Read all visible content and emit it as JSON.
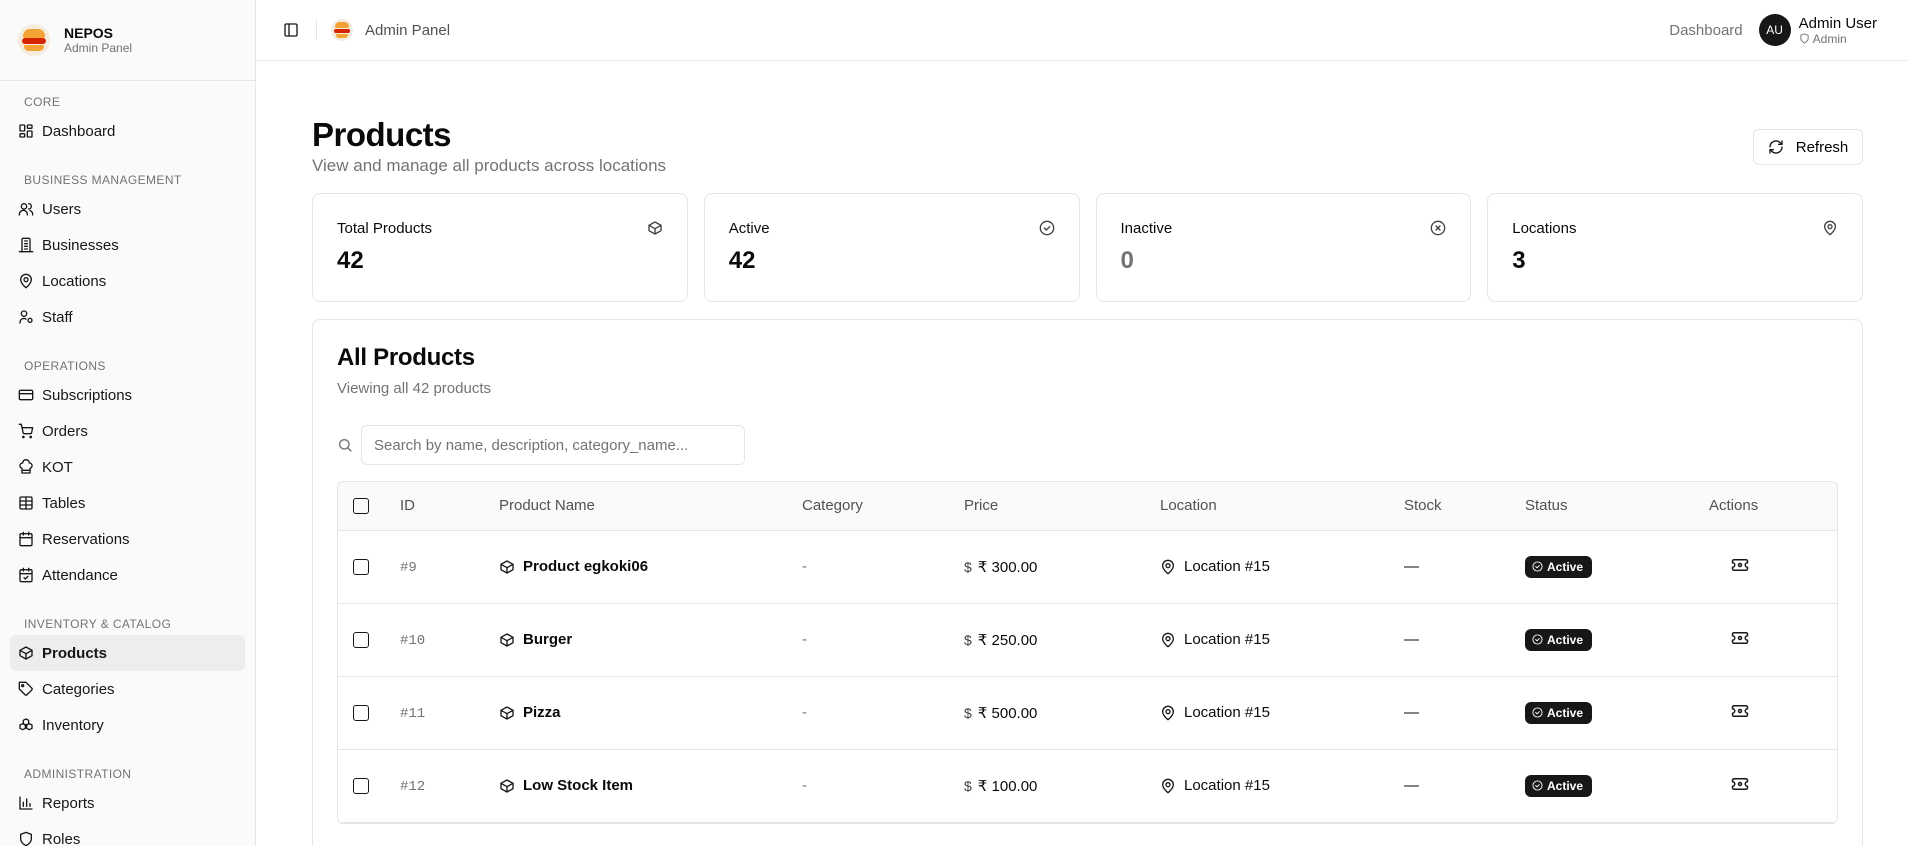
{
  "brand": {
    "name": "NEPOS",
    "subtitle": "Admin Panel"
  },
  "sidebar": {
    "sections": [
      {
        "label": "CORE",
        "items": [
          {
            "label": "Dashboard",
            "icon": "dashboard-icon"
          }
        ]
      },
      {
        "label": "BUSINESS MANAGEMENT",
        "items": [
          {
            "label": "Users",
            "icon": "users-icon"
          },
          {
            "label": "Businesses",
            "icon": "building-icon"
          },
          {
            "label": "Locations",
            "icon": "map-pin-icon"
          },
          {
            "label": "Staff",
            "icon": "staff-icon"
          }
        ]
      },
      {
        "label": "OPERATIONS",
        "items": [
          {
            "label": "Subscriptions",
            "icon": "credit-card-icon"
          },
          {
            "label": "Orders",
            "icon": "cart-icon"
          },
          {
            "label": "KOT",
            "icon": "chef-hat-icon"
          },
          {
            "label": "Tables",
            "icon": "grid-icon"
          },
          {
            "label": "Reservations",
            "icon": "calendar-icon"
          },
          {
            "label": "Attendance",
            "icon": "calendar-check-icon"
          }
        ]
      },
      {
        "label": "INVENTORY & CATALOG",
        "items": [
          {
            "label": "Products",
            "icon": "package-icon",
            "active": true
          },
          {
            "label": "Categories",
            "icon": "tag-icon"
          },
          {
            "label": "Inventory",
            "icon": "boxes-icon"
          }
        ]
      },
      {
        "label": "ADMINISTRATION",
        "items": [
          {
            "label": "Reports",
            "icon": "bar-chart-icon"
          },
          {
            "label": "Roles",
            "icon": "roles-icon"
          }
        ]
      }
    ]
  },
  "topbar": {
    "title": "Admin Panel",
    "dashboard_link": "Dashboard",
    "user": {
      "initials": "AU",
      "name": "Admin User",
      "role": "Admin"
    }
  },
  "page": {
    "title": "Products",
    "subtitle": "View and manage all products across locations",
    "refresh_label": "Refresh"
  },
  "stats": [
    {
      "label": "Total Products",
      "value": "42",
      "icon": "package-icon"
    },
    {
      "label": "Active",
      "value": "42",
      "icon": "check-circle-icon"
    },
    {
      "label": "Inactive",
      "value": "0",
      "icon": "x-circle-icon"
    },
    {
      "label": "Locations",
      "value": "3",
      "icon": "map-pin-icon"
    }
  ],
  "products": {
    "title": "All Products",
    "subtitle": "Viewing all 42 products",
    "search_placeholder": "Search by name, description, category_name...",
    "columns": [
      "ID",
      "Product Name",
      "Category",
      "Price",
      "Location",
      "Stock",
      "Status",
      "Actions"
    ],
    "rows": [
      {
        "id": "#9",
        "name": "Product egkoki06",
        "category": "-",
        "currency": "$",
        "price": "₹ 300.00",
        "location": "Location #15",
        "stock": "—",
        "status": "Active"
      },
      {
        "id": "#10",
        "name": "Burger",
        "category": "-",
        "currency": "$",
        "price": "₹ 250.00",
        "location": "Location #15",
        "stock": "—",
        "status": "Active"
      },
      {
        "id": "#11",
        "name": "Pizza",
        "category": "-",
        "currency": "$",
        "price": "₹ 500.00",
        "location": "Location #15",
        "stock": "—",
        "status": "Active"
      },
      {
        "id": "#12",
        "name": "Low Stock Item",
        "category": "-",
        "currency": "$",
        "price": "₹ 100.00",
        "location": "Location #15",
        "stock": "—",
        "status": "Active"
      }
    ]
  },
  "colors": {
    "accent": "#171717",
    "border": "#e5e5e5",
    "muted": "#737373",
    "sidebar_bg": "#fafafa"
  }
}
